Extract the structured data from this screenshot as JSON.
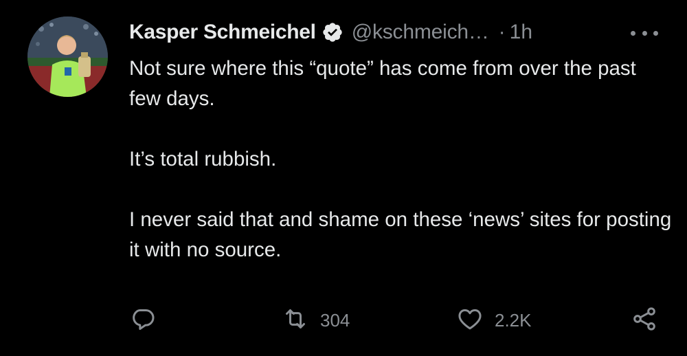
{
  "tweet": {
    "author": {
      "display_name": "Kasper Schmeichel",
      "handle": "@kschmeich…",
      "verified": true,
      "avatar_icon": "avatar-photo"
    },
    "separator": "·",
    "time": "1h",
    "more_icon": "more-dots-icon",
    "text": {
      "paragraph_1": "Not sure where this “quote” has come from over the past few days.",
      "paragraph_2": "It’s total rubbish.",
      "paragraph_3": "I never said that and shame on these ‘news’ sites for posting it with no source."
    },
    "actions": {
      "reply": {
        "icon": "reply-icon",
        "count": ""
      },
      "retweet": {
        "icon": "retweet-icon",
        "count": "304"
      },
      "like": {
        "icon": "heart-icon",
        "count": "2.2K"
      },
      "share": {
        "icon": "share-icon"
      }
    }
  },
  "colors": {
    "background": "#000000",
    "primary_text": "#e7e9ea",
    "secondary_text": "#8b8f94",
    "verified_badge": "#e7e9ea"
  }
}
